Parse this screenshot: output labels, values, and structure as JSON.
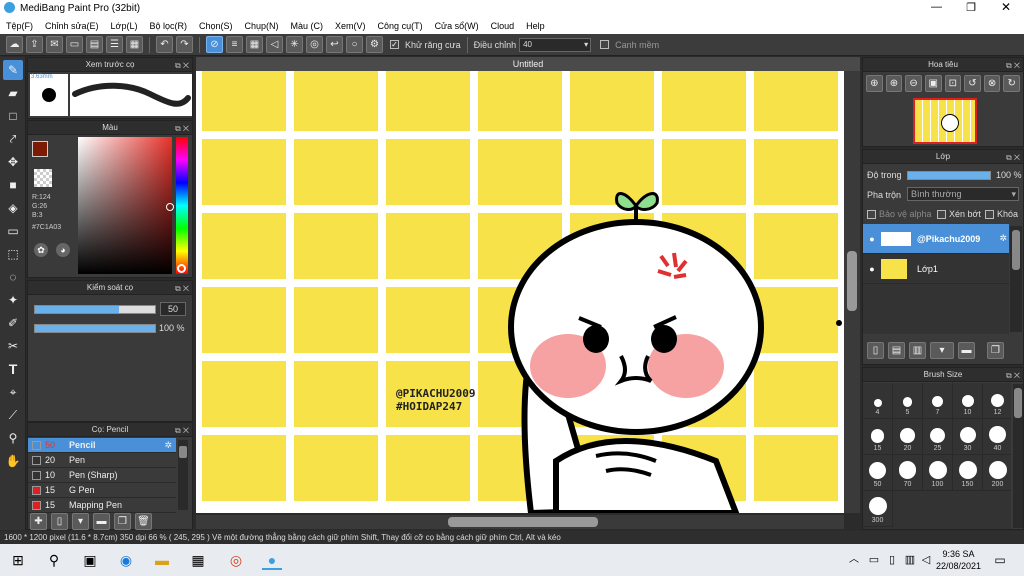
{
  "app": {
    "title": "MediBang Paint Pro (32bit)"
  },
  "menu": [
    "Tệp(F)",
    "Chỉnh sửa(E)",
    "Lớp(L)",
    "Bộ lọc(R)",
    "Chọn(S)",
    "Chụp(N)",
    "Màu (C)",
    "Xem(V)",
    "Công cụ(T)",
    "Cửa sổ(W)",
    "Cloud",
    "Help"
  ],
  "toolbar": {
    "antialias_label": "Khử răng cưa",
    "adjust_label": "Điều chỉnh",
    "adjust_value": "40",
    "edge_label": "Canh mềm"
  },
  "canvas": {
    "doc_title": "Untitled",
    "watermark1": "@PIKACHU2009",
    "watermark2": "#HOIDAP247",
    "grid_color": "#f7e24a"
  },
  "brush_preview": {
    "title": "Xem trước cọ",
    "size": "3.63mm"
  },
  "color_panel": {
    "title": "Màu",
    "r": "R:124",
    "g": "G:26",
    "b": "B:3",
    "hex": "#7C1A03",
    "main_color": "#7c1a03"
  },
  "brush_control": {
    "title": "Kiểm soát cọ",
    "size_value": "50",
    "opacity_value": "100 %",
    "size_level": 0.7,
    "opacity_level": 1.0
  },
  "brush_list": {
    "title": "Cọ: Pencil",
    "items": [
      {
        "size": "50",
        "name": "Pencil",
        "color": "#4a90d9"
      },
      {
        "size": "20",
        "name": "Pen",
        "color": "#333333"
      },
      {
        "size": "10",
        "name": "Pen (Sharp)",
        "color": "#333333"
      },
      {
        "size": "15",
        "name": "G Pen",
        "color": "#e02020"
      },
      {
        "size": "15",
        "name": "Mapping Pen",
        "color": "#e02020"
      }
    ]
  },
  "navigator": {
    "title": "Hoa tiêu"
  },
  "layer_panel": {
    "title": "Lớp",
    "opacity_label": "Độ trong",
    "opacity_value": "100 %",
    "opacity_level": 1.0,
    "blend_label": "Pha trộn",
    "blend_value": "Bình thường",
    "protect_label": "Bảo vệ alpha",
    "clip_label": "Xén bớt",
    "lock_label": "Khóa",
    "layers": [
      {
        "name": "@Pikachu2009"
      },
      {
        "name": "Lớp1"
      }
    ]
  },
  "brush_size": {
    "title": "Brush Size",
    "sizes": [
      "4",
      "5",
      "7",
      "10",
      "12",
      "15",
      "20",
      "25",
      "30",
      "40",
      "50",
      "70",
      "100",
      "150",
      "200",
      "300"
    ]
  },
  "status": {
    "text": "1600 * 1200 pixel   (11.6 * 8.7cm)   350 dpi   66 %   ( 245, 295 )   Vẽ một đường thẳng bằng cách giữ phím Shift, Thay đổi cỡ cọ bằng cách giữ phím Ctrl, Alt và kéo"
  },
  "taskbar": {
    "time": "9:36 SA",
    "date": "22/08/2021"
  }
}
